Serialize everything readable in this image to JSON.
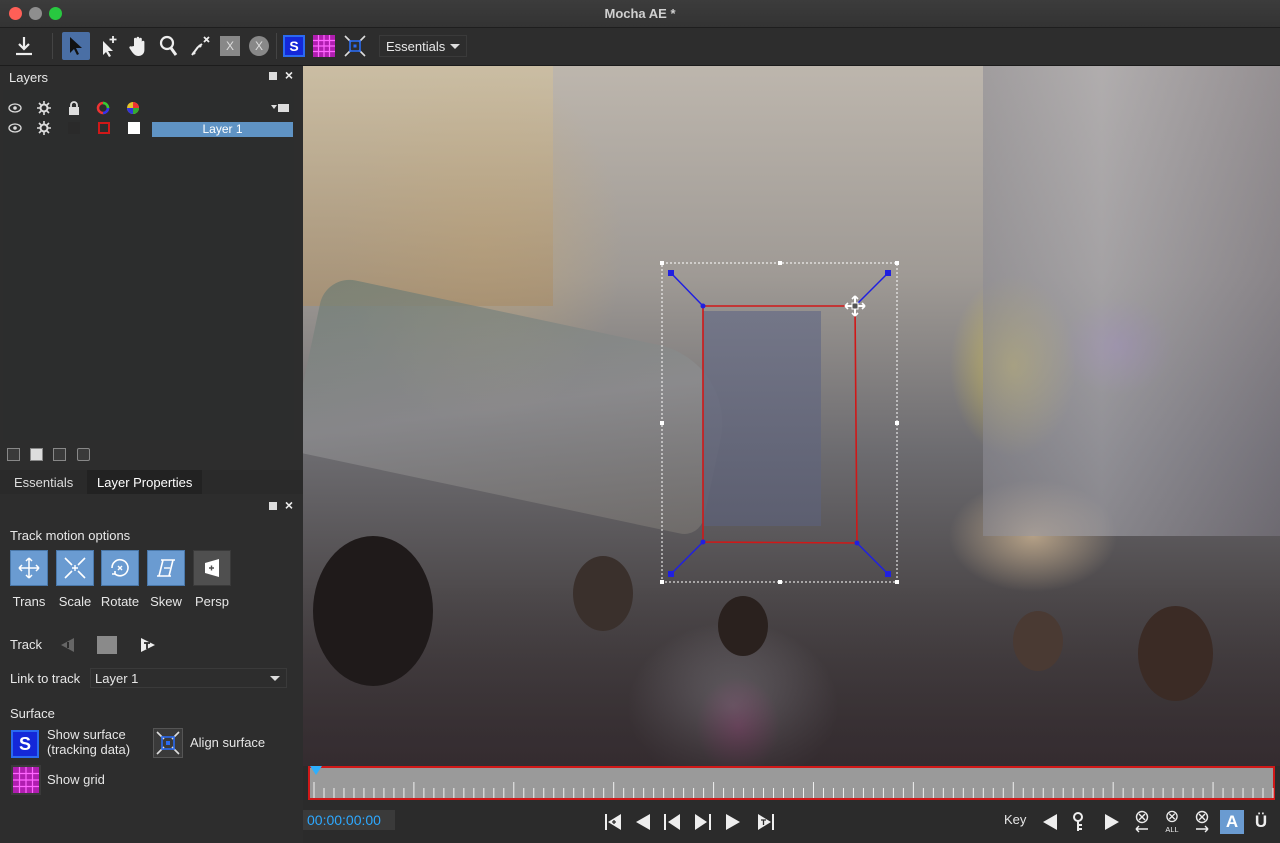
{
  "window": {
    "title": "Mocha AE *"
  },
  "toolbar": {
    "workspace_label": "Essentials"
  },
  "layers_panel": {
    "title": "Layers",
    "layers": [
      {
        "name": "Layer 1",
        "color": "#d01818"
      }
    ]
  },
  "properties": {
    "tabs": [
      "Essentials",
      "Layer Properties"
    ],
    "track_motion_title": "Track motion options",
    "motion_buttons": [
      "Trans",
      "Scale",
      "Rotate",
      "Skew",
      "Persp"
    ],
    "track_label": "Track",
    "link_label": "Link to track",
    "link_value": "Layer 1",
    "surface_label": "Surface",
    "show_surface_label_1": "Show surface",
    "show_surface_label_2": "(tracking data)",
    "align_surface_label": "Align surface",
    "show_grid_label": "Show grid"
  },
  "timeline": {
    "timecode": "00:00:00:00"
  },
  "keys": {
    "key_label": "Key",
    "all_label": "ALL"
  },
  "colors": {
    "accent": "#6a9bd1",
    "timecode": "#2da8ff",
    "layer_spline": "#d01818",
    "surface": "#2020e0",
    "grid": "#cc22cc"
  },
  "icons": [
    "export-icon",
    "select-icon",
    "add-point-icon",
    "hand-icon",
    "zoom-icon",
    "delete-point-icon",
    "clip-x-icon",
    "clip-x-round-icon",
    "surface-icon",
    "grid-icon",
    "align-surface-icon"
  ]
}
